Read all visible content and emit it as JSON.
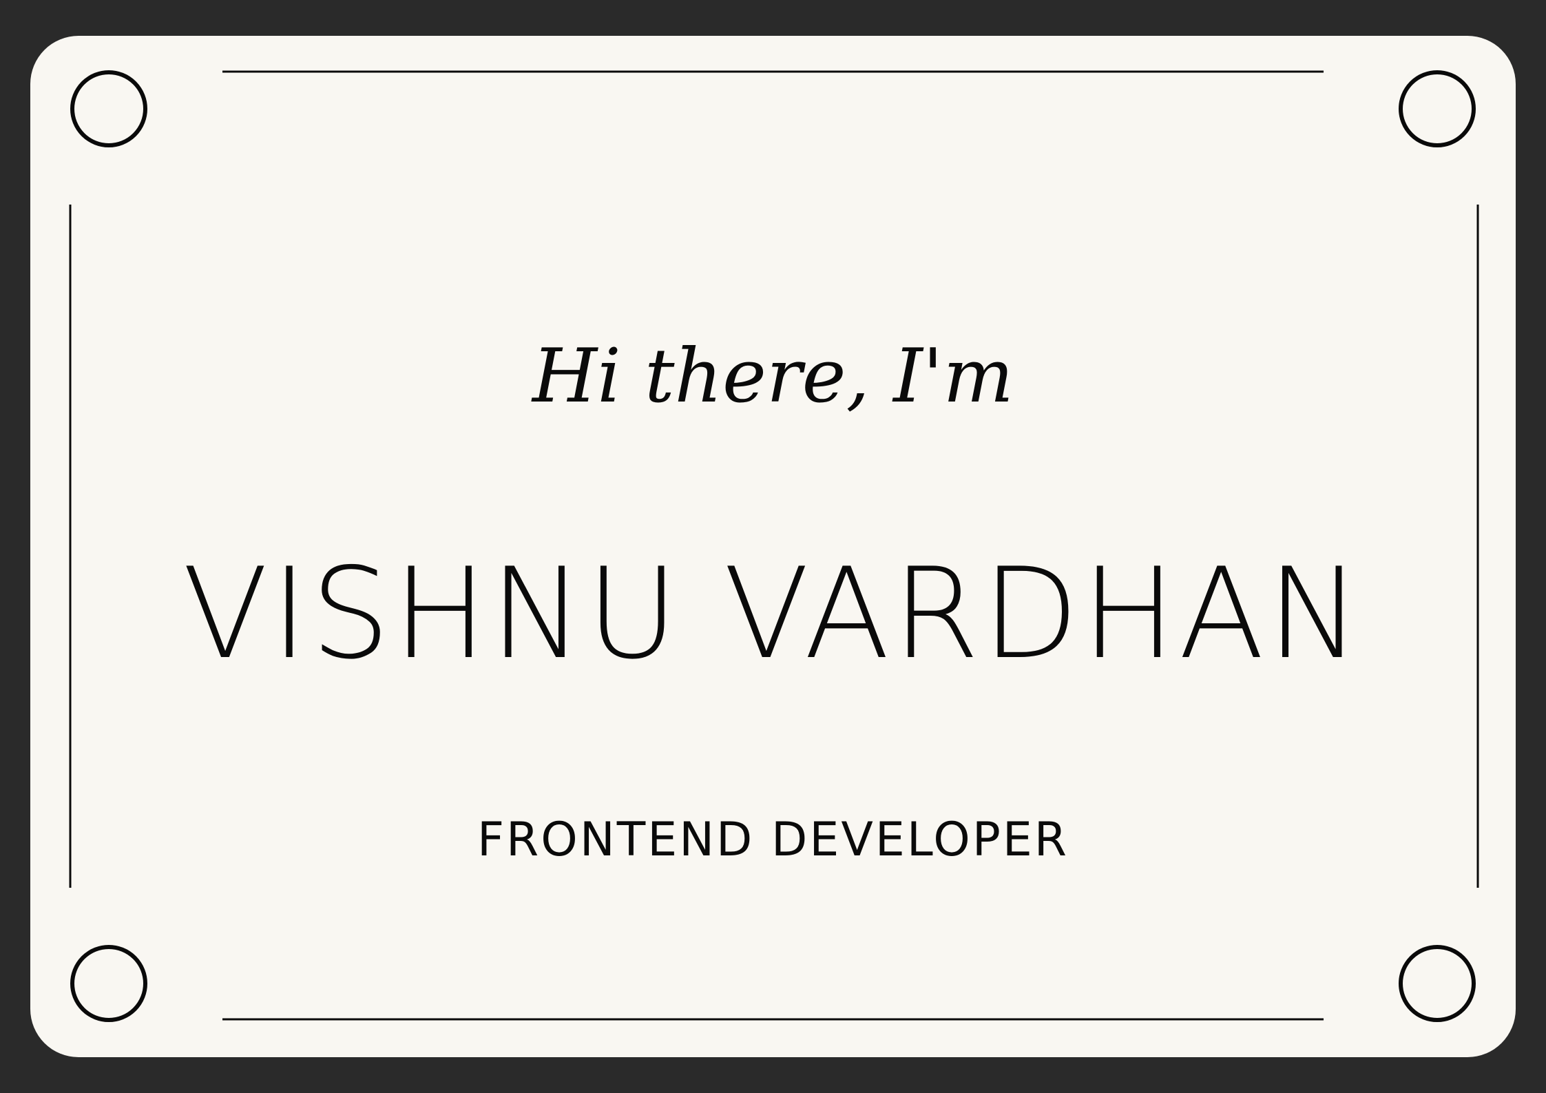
{
  "card": {
    "greeting": "Hi there, I'm",
    "name": "VISHNU VARDHAN",
    "role": "FRONTEND DEVELOPER"
  },
  "colors": {
    "frame": "#2a2a2a",
    "card_background": "#f9f7f2",
    "ink": "#0a0a0a"
  },
  "decorations": {
    "corner_icon": "ring-icon"
  }
}
